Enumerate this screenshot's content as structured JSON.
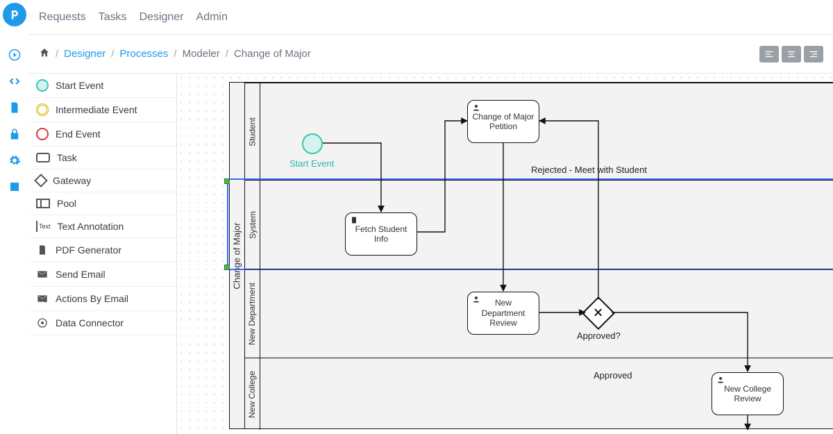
{
  "topnav": {
    "items": [
      "Requests",
      "Tasks",
      "Designer",
      "Admin"
    ]
  },
  "breadcrumb": {
    "designer": "Designer",
    "processes": "Processes",
    "modeler": "Modeler",
    "current": "Change of Major"
  },
  "palette": {
    "start_event": "Start Event",
    "intermediate_event": "Intermediate Event",
    "end_event": "End Event",
    "task": "Task",
    "gateway": "Gateway",
    "pool": "Pool",
    "text_annotation": "Text Annotation",
    "pdf_generator": "PDF Generator",
    "send_email": "Send Email",
    "actions_by_email": "Actions By Email",
    "data_connector": "Data Connector",
    "text_annotation_icon": "Text"
  },
  "diagram": {
    "pool_name": "Change of Major",
    "lanes": {
      "student": "Student",
      "system": "System",
      "new_department": "New Department",
      "new_college": "New College"
    },
    "start_event_label": "Start Event",
    "tasks": {
      "change_petition": "Change of Major Petition",
      "fetch_student": "Fetch Student Info",
      "new_dept_review": "New Department Review",
      "new_college_review": "New College Review"
    },
    "gateway_label": "Approved?",
    "edge_labels": {
      "rejected": "Rejected - Meet with Student",
      "approved": "Approved"
    }
  },
  "leftbar_icons": [
    "play",
    "code",
    "doc",
    "lock",
    "gear",
    "text"
  ]
}
